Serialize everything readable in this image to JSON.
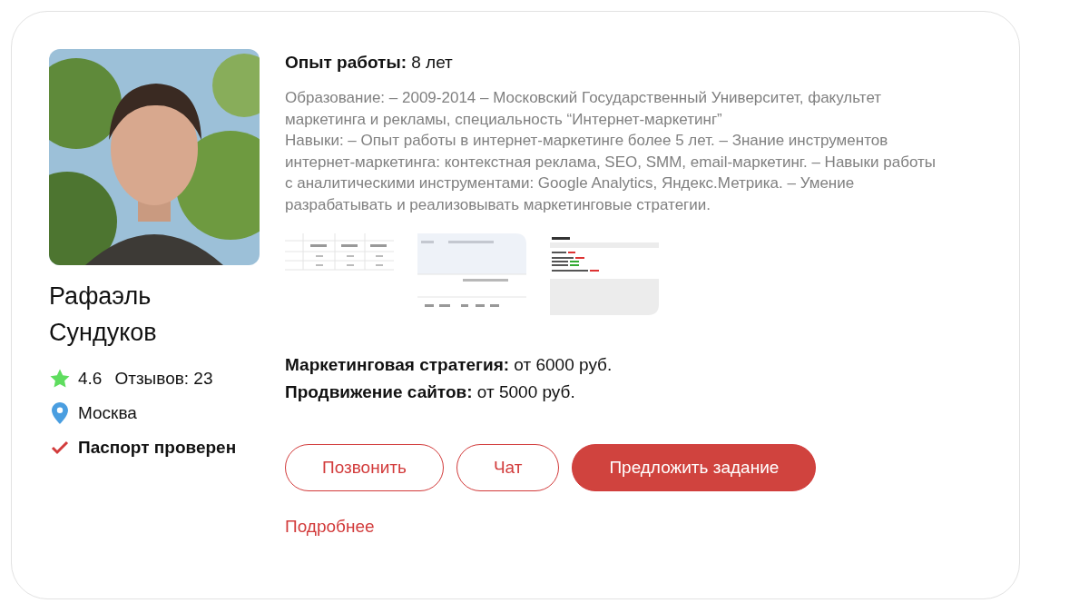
{
  "profile": {
    "name": "Рафаэль Сундуков",
    "rating": "4.6",
    "reviews": "Отзывов: 23",
    "city": "Москва",
    "verified": {
      "label": "Паспорт проверен",
      "checked": true
    }
  },
  "experience": {
    "label": "Опыт работы:",
    "value": "8 лет"
  },
  "description": [
    "Образование: – 2009-2014 – Московский Государственный Университет, факультет маркетинга и рекламы, специальность “Интернет-маркетинг”",
    "Навыки: – Опыт работы в интернет-маркетинге более 5 лет. – Знание инструментов интернет-маркетинга: контекстная реклама, SEO, SMM, email-маркетинг. – Навыки работы с аналитическими инструментами: Google Analytics, Яндекс.Метрика. – Умение разрабатывать и реализовывать маркетинговые стратегии."
  ],
  "portfolio": [
    {
      "kind": "table"
    },
    {
      "kind": "dashboard"
    },
    {
      "kind": "report"
    }
  ],
  "prices": [
    {
      "label": "Маркетинговая стратегия:",
      "value": "от 6000 руб."
    },
    {
      "label": "Продвижение сайтов:",
      "value": "от 5000 руб."
    }
  ],
  "buttons": [
    {
      "label": "Позвонить",
      "kind": "outline"
    },
    {
      "label": "Чат",
      "kind": "outline"
    },
    {
      "label": "Предложить задание",
      "kind": "primary"
    }
  ],
  "more_link": "Подробнее"
}
